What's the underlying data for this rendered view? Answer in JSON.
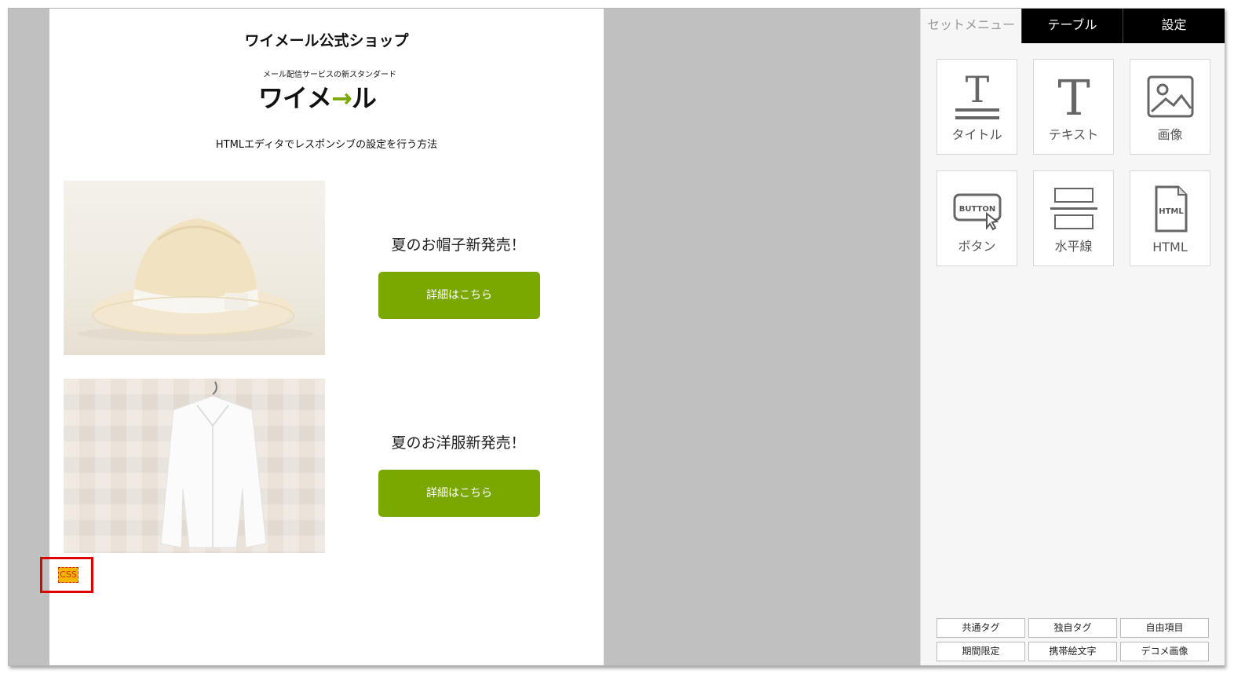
{
  "email": {
    "shop_title": "ワイメール公式ショップ",
    "logo": {
      "tagline": "メール配信サービスの新スタンダード",
      "wordmark_left": "ワイメ",
      "wordmark_arrow": "→",
      "wordmark_right": "ル"
    },
    "subtitle": "HTMLエディタでレスポンシブの設定を行う方法",
    "products": [
      {
        "title": "夏のお帽子新発売！",
        "button": "詳細はこちら"
      },
      {
        "title": "夏のお洋服新発売！",
        "button": "詳細はこちら"
      }
    ],
    "css_badge": "CSS"
  },
  "panel": {
    "tabs": [
      "セットメニュー",
      "テーブル",
      "設定"
    ],
    "tiles": [
      {
        "label": "タイトル",
        "icon": "title-icon"
      },
      {
        "label": "テキスト",
        "icon": "text-icon"
      },
      {
        "label": "画像",
        "icon": "image-icon"
      },
      {
        "label": "ボタン",
        "icon": "button-icon"
      },
      {
        "label": "水平線",
        "icon": "horizontal-line-icon"
      },
      {
        "label": "HTML",
        "icon": "html-file-icon"
      }
    ],
    "button_icon_text": "BUTTON",
    "html_icon_text": "HTML",
    "bottom_buttons": [
      "共通タグ",
      "独自タグ",
      "自由項目",
      "期間限定",
      "携帯絵文字",
      "デコメ画像"
    ]
  },
  "colors": {
    "accent_green": "#7aa800",
    "highlight_red": "#e00000",
    "tab_black": "#000000"
  }
}
